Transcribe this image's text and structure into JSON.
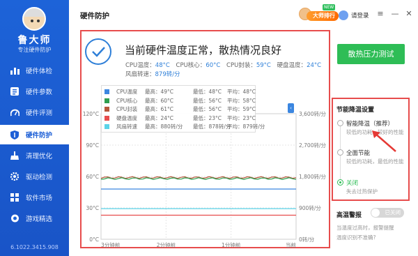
{
  "app": {
    "name": "鲁大师",
    "tagline": "专注硬件防护",
    "version": "6.1022.3415.908"
  },
  "sidebar": {
    "items": [
      {
        "label": "硬件体检",
        "icon": "chart-icon"
      },
      {
        "label": "硬件参数",
        "icon": "list-icon"
      },
      {
        "label": "硬件评测",
        "icon": "speed-icon"
      },
      {
        "label": "硬件防护",
        "icon": "shield-icon"
      },
      {
        "label": "清理优化",
        "icon": "broom-icon"
      },
      {
        "label": "驱动检测",
        "icon": "gear-icon"
      },
      {
        "label": "软件市场",
        "icon": "grid-icon"
      },
      {
        "label": "游戏精选",
        "icon": "game-icon"
      }
    ],
    "active_index": 3
  },
  "header": {
    "title": "硬件防护",
    "rank_label": "大师排行",
    "new_tag": "NEW",
    "login_label": "请登录",
    "win_buttons": {
      "menu": "≡",
      "minimize": "—",
      "close": "✕"
    }
  },
  "status": {
    "title": "当前硬件温度正常，散热情况良好",
    "readings": [
      {
        "label": "CPU温度：",
        "value": "48°C"
      },
      {
        "label": "CPU核心：",
        "value": "60°C"
      },
      {
        "label": "CPU封装：",
        "value": "59°C"
      },
      {
        "label": "硬盘温度：",
        "value": "24°C"
      },
      {
        "label": "风扇转速：",
        "value": "879转/分"
      }
    ]
  },
  "chart_data": {
    "type": "line",
    "y_left_ticks": [
      "120°C",
      "90°C",
      "60°C",
      "30°C",
      "0°C"
    ],
    "y_right_ticks": [
      "3,600转/分",
      "2,700转/分",
      "1,800转/分",
      "900转/分",
      "0转/分"
    ],
    "x_ticks": [
      "3分钟前",
      "2分钟前",
      "1分钟前",
      "当前"
    ],
    "ylim_temp": [
      0,
      120
    ],
    "ylim_fan": [
      0,
      3600
    ],
    "grid": true,
    "series": [
      {
        "name": "CPU温度",
        "color": "#3b86e0",
        "axis": "temp",
        "value": 48,
        "high": "49°C",
        "low": "48°C",
        "avg": "48°C"
      },
      {
        "name": "CPU核心",
        "color": "#2e9e4f",
        "axis": "temp",
        "value": 58,
        "high": "60°C",
        "low": "56°C",
        "avg": "58°C"
      },
      {
        "name": "CPU封装",
        "color": "#b5563a",
        "axis": "temp",
        "value": 59,
        "high": "61°C",
        "low": "56°C",
        "avg": "59°C"
      },
      {
        "name": "硬盘温度",
        "color": "#e84d4d",
        "axis": "temp",
        "value": 23,
        "high": "24°C",
        "low": "23°C",
        "avg": "23°C"
      },
      {
        "name": "风扇转速",
        "color": "#5bd3e8",
        "axis": "fan",
        "value": 879,
        "high": "880转/分",
        "low": "878转/分",
        "avg": "879转/分"
      }
    ],
    "legend_labels": {
      "high": "最高：",
      "low": "最低：",
      "avg": "平均："
    }
  },
  "right": {
    "stress_button": "散热压力测试",
    "cool_title": "节能降温设置",
    "options": [
      {
        "name": "智能降温（推荐）",
        "desc": "较低的功耗，较好的性能",
        "selected": false
      },
      {
        "name": "全面节能",
        "desc": "较低的功耗，最低的性能",
        "selected": false
      },
      {
        "name": "关闭",
        "desc": "失去过热保护",
        "selected": true
      }
    ],
    "alarm_title": "高温警报",
    "alarm_toggle": "已关闭",
    "alarm_desc": "当温度过高时，报警提醒",
    "alarm_link": "温度识别不准确?"
  }
}
